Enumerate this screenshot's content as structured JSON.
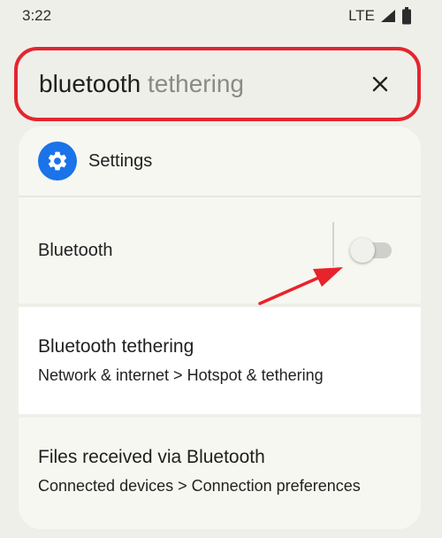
{
  "status_bar": {
    "time": "3:22",
    "network": "LTE",
    "signal_icon": "signal-icon",
    "battery_icon": "battery-icon"
  },
  "search": {
    "typed_text": "bluetooth",
    "suggestion_text": "tethering",
    "clear_icon": "close-icon",
    "highlight_color": "#e3262f"
  },
  "results": {
    "header": {
      "icon": "gear-icon",
      "icon_color": "#1a73e8",
      "label": "Settings"
    },
    "items": [
      {
        "title": "Bluetooth",
        "toggle": {
          "state": "off"
        }
      },
      {
        "title": "Bluetooth tethering",
        "subtitle": "Network & internet > Hotspot & tethering"
      },
      {
        "title": "Files received via Bluetooth",
        "subtitle": "Connected devices > Connection preferences"
      }
    ]
  },
  "annotation": {
    "arrow_color": "#e8232b"
  }
}
